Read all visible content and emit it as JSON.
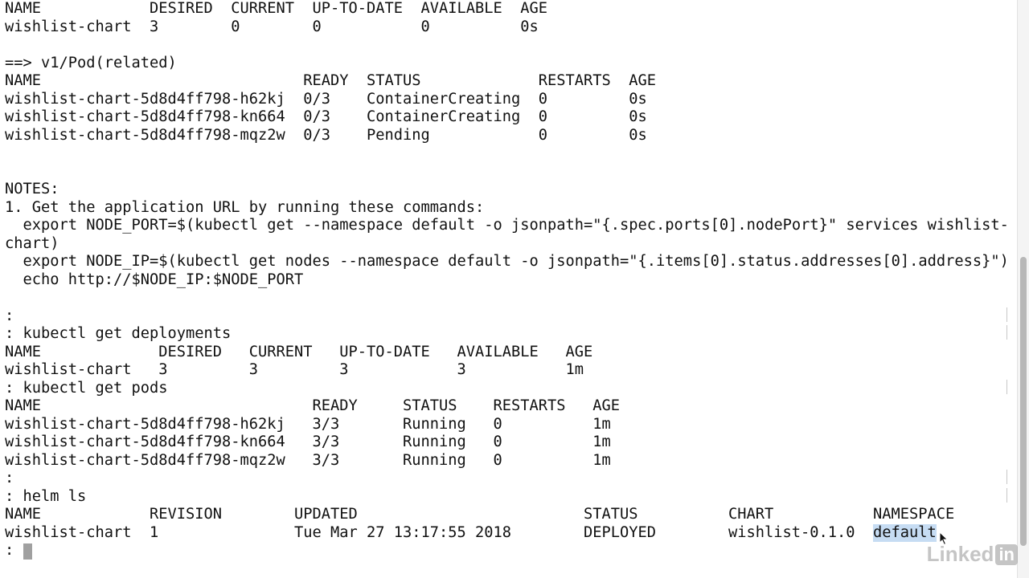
{
  "terminal": {
    "lines": [
      {
        "cols": [
          {
            "c": 0,
            "t": "NAME"
          },
          {
            "c": 16,
            "t": "DESIRED"
          },
          {
            "c": 25,
            "t": "CURRENT"
          },
          {
            "c": 34,
            "t": "UP-TO-DATE"
          },
          {
            "c": 46,
            "t": "AVAILABLE"
          },
          {
            "c": 57,
            "t": "AGE"
          }
        ]
      },
      {
        "cols": [
          {
            "c": 0,
            "t": "wishlist-chart"
          },
          {
            "c": 16,
            "t": "3"
          },
          {
            "c": 25,
            "t": "0"
          },
          {
            "c": 34,
            "t": "0"
          },
          {
            "c": 46,
            "t": "0"
          },
          {
            "c": 57,
            "t": "0s"
          }
        ]
      },
      {
        "cols": []
      },
      {
        "cols": [
          {
            "c": 0,
            "t": "==> v1/Pod(related)"
          }
        ]
      },
      {
        "cols": [
          {
            "c": 0,
            "t": "NAME"
          },
          {
            "c": 33,
            "t": "READY"
          },
          {
            "c": 40,
            "t": "STATUS"
          },
          {
            "c": 59,
            "t": "RESTARTS"
          },
          {
            "c": 69,
            "t": "AGE"
          }
        ]
      },
      {
        "cols": [
          {
            "c": 0,
            "t": "wishlist-chart-5d8d4ff798-h62kj"
          },
          {
            "c": 33,
            "t": "0/3"
          },
          {
            "c": 40,
            "t": "ContainerCreating"
          },
          {
            "c": 59,
            "t": "0"
          },
          {
            "c": 69,
            "t": "0s"
          }
        ]
      },
      {
        "cols": [
          {
            "c": 0,
            "t": "wishlist-chart-5d8d4ff798-kn664"
          },
          {
            "c": 33,
            "t": "0/3"
          },
          {
            "c": 40,
            "t": "ContainerCreating"
          },
          {
            "c": 59,
            "t": "0"
          },
          {
            "c": 69,
            "t": "0s"
          }
        ]
      },
      {
        "cols": [
          {
            "c": 0,
            "t": "wishlist-chart-5d8d4ff798-mqz2w"
          },
          {
            "c": 33,
            "t": "0/3"
          },
          {
            "c": 40,
            "t": "Pending"
          },
          {
            "c": 59,
            "t": "0"
          },
          {
            "c": 69,
            "t": "0s"
          }
        ]
      },
      {
        "cols": []
      },
      {
        "cols": []
      },
      {
        "cols": [
          {
            "c": 0,
            "t": "NOTES:"
          }
        ]
      },
      {
        "cols": [
          {
            "c": 0,
            "t": "1. Get the application URL by running these commands:"
          }
        ]
      },
      {
        "cols": [
          {
            "c": 0,
            "t": "  export NODE_PORT=$(kubectl get --namespace default -o jsonpath=\"{.spec.ports[0].nodePort}\" services wishlist-"
          }
        ]
      },
      {
        "cols": [
          {
            "c": 0,
            "t": "chart)"
          }
        ]
      },
      {
        "cols": [
          {
            "c": 0,
            "t": "  export NODE_IP=$(kubectl get nodes --namespace default -o jsonpath=\"{.items[0].status.addresses[0].address}\")"
          }
        ]
      },
      {
        "cols": [
          {
            "c": 0,
            "t": "  echo http://$NODE_IP:$NODE_PORT"
          }
        ]
      },
      {
        "cols": []
      },
      {
        "cols": [
          {
            "c": 0,
            "t": ":"
          }
        ],
        "tick": true
      },
      {
        "cols": [
          {
            "c": 0,
            "t": ": kubectl get deployments"
          }
        ],
        "tick": true
      },
      {
        "cols": [
          {
            "c": 0,
            "t": "NAME"
          },
          {
            "c": 17,
            "t": "DESIRED"
          },
          {
            "c": 27,
            "t": "CURRENT"
          },
          {
            "c": 37,
            "t": "UP-TO-DATE"
          },
          {
            "c": 50,
            "t": "AVAILABLE"
          },
          {
            "c": 62,
            "t": "AGE"
          }
        ]
      },
      {
        "cols": [
          {
            "c": 0,
            "t": "wishlist-chart"
          },
          {
            "c": 17,
            "t": "3"
          },
          {
            "c": 27,
            "t": "3"
          },
          {
            "c": 37,
            "t": "3"
          },
          {
            "c": 50,
            "t": "3"
          },
          {
            "c": 62,
            "t": "1m"
          }
        ]
      },
      {
        "cols": [
          {
            "c": 0,
            "t": ": kubectl get pods"
          }
        ],
        "tick": true
      },
      {
        "cols": [
          {
            "c": 0,
            "t": "NAME"
          },
          {
            "c": 34,
            "t": "READY"
          },
          {
            "c": 44,
            "t": "STATUS"
          },
          {
            "c": 54,
            "t": "RESTARTS"
          },
          {
            "c": 65,
            "t": "AGE"
          }
        ]
      },
      {
        "cols": [
          {
            "c": 0,
            "t": "wishlist-chart-5d8d4ff798-h62kj"
          },
          {
            "c": 34,
            "t": "3/3"
          },
          {
            "c": 44,
            "t": "Running"
          },
          {
            "c": 54,
            "t": "0"
          },
          {
            "c": 65,
            "t": "1m"
          }
        ]
      },
      {
        "cols": [
          {
            "c": 0,
            "t": "wishlist-chart-5d8d4ff798-kn664"
          },
          {
            "c": 34,
            "t": "3/3"
          },
          {
            "c": 44,
            "t": "Running"
          },
          {
            "c": 54,
            "t": "0"
          },
          {
            "c": 65,
            "t": "1m"
          }
        ]
      },
      {
        "cols": [
          {
            "c": 0,
            "t": "wishlist-chart-5d8d4ff798-mqz2w"
          },
          {
            "c": 34,
            "t": "3/3"
          },
          {
            "c": 44,
            "t": "Running"
          },
          {
            "c": 54,
            "t": "0"
          },
          {
            "c": 65,
            "t": "1m"
          }
        ]
      },
      {
        "cols": [
          {
            "c": 0,
            "t": ":"
          }
        ],
        "tick": true
      },
      {
        "cols": [
          {
            "c": 0,
            "t": ": helm ls"
          }
        ],
        "tick": true
      },
      {
        "cols": [
          {
            "c": 0,
            "t": "NAME"
          },
          {
            "c": 16,
            "t": "REVISION"
          },
          {
            "c": 32,
            "t": "UPDATED"
          },
          {
            "c": 64,
            "t": "STATUS"
          },
          {
            "c": 80,
            "t": "CHART"
          },
          {
            "c": 96,
            "t": "NAMESPACE"
          }
        ]
      },
      {
        "cols": [
          {
            "c": 0,
            "t": "wishlist-chart"
          },
          {
            "c": 16,
            "t": "1"
          },
          {
            "c": 32,
            "t": "Tue Mar 27 13:17:55 2018"
          },
          {
            "c": 64,
            "t": "DEPLOYED"
          },
          {
            "c": 80,
            "t": "wishlist-0.1.0"
          },
          {
            "c": 96,
            "t": "default",
            "hl": true
          }
        ]
      },
      {
        "cols": [
          {
            "c": 0,
            "t": ": "
          }
        ],
        "cursor": true
      }
    ]
  },
  "selection_color": "#c6dcf3",
  "watermark": {
    "text": "Linked",
    "box": "in"
  },
  "icons": {
    "pointer": "mouse-pointer-icon"
  }
}
